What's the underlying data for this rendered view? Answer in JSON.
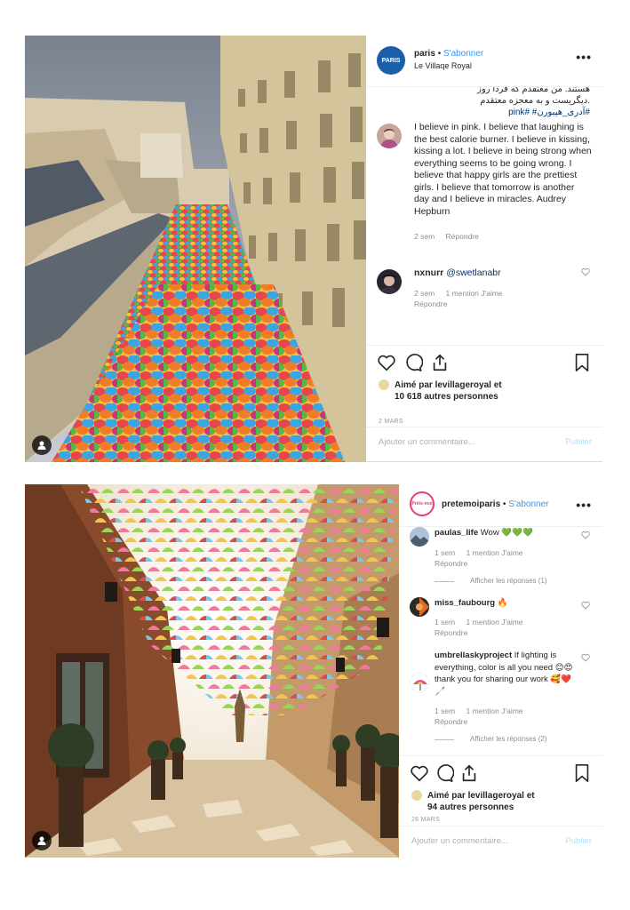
{
  "post1": {
    "username": "paris",
    "separator": "•",
    "follow_label": "S'abonner",
    "location": "Le Villaqe Royal",
    "avatar_text": "PARIS",
    "more_icon": "•••",
    "rtl_lines": [
      "هستند. من معتقدم كه فردا روز",
      ".ديگريست و به معجزه معتقدم",
      "#آدری_هپبورن# #pink"
    ],
    "caption": "I believe in pink. I believe that laughing is the best calorie burner. I believe in kissing, kissing a lot. I believe in being strong when everything seems to be going wrong. I believe that happy girls are the prettiest girls. I believe that tomorrow is another day and I believe in miracles. Audrey Hepburn",
    "caption_time": "2 sem",
    "caption_reply": "Répondre",
    "comment": {
      "username": "nxnurr",
      "mention": "@swetlanabr",
      "time": "2 sem",
      "likes": "1 mention J'aime",
      "reply": "Répondre"
    },
    "likes_line1": "Aimé par levillageroyal et",
    "likes_line2": "10 618 autres personnes",
    "date": "2 MARS",
    "add_comment_placeholder": "Ajouter un commentaire...",
    "publish_label": "Publier"
  },
  "post2": {
    "username": "pretemoiparis",
    "separator": "•",
    "follow_label": "S'abonner",
    "avatar_text": "Prête-moi",
    "more_icon": "•••",
    "comments": [
      {
        "username": "paulas_life",
        "text": "Wow 💚💚💚",
        "time": "1 sem",
        "likes": "1 mention J'aime",
        "reply": "Répondre",
        "replies": "Afficher les réponses (1)"
      },
      {
        "username": "miss_faubourg",
        "text": "🔥",
        "time": "1 sem",
        "likes": "1 mention J'aime",
        "reply": "Répondre",
        "replies": ""
      },
      {
        "username": "umbrellaskyproject",
        "text": "If lighting is everything, color is all you need 😊😍 thank you for sharing our work 🥰❤️🦯",
        "time": "1 sem",
        "likes": "1 mention J'aime",
        "reply": "Répondre",
        "replies": "Afficher les réponses (2)"
      }
    ],
    "likes_line1": "Aimé par levillageroyal et",
    "likes_line2": "94 autres personnes",
    "date": "26 MARS",
    "add_comment_placeholder": "Ajouter un commentaire...",
    "publish_label": "Publier"
  },
  "colors": {
    "follow_blue": "#3897f0",
    "publish_disabled": "#b2dffc",
    "meta_gray": "#8e8e8e",
    "paris_avatar": "#1b5ea8",
    "pretemoi_avatar_ring": "#e8406b"
  }
}
